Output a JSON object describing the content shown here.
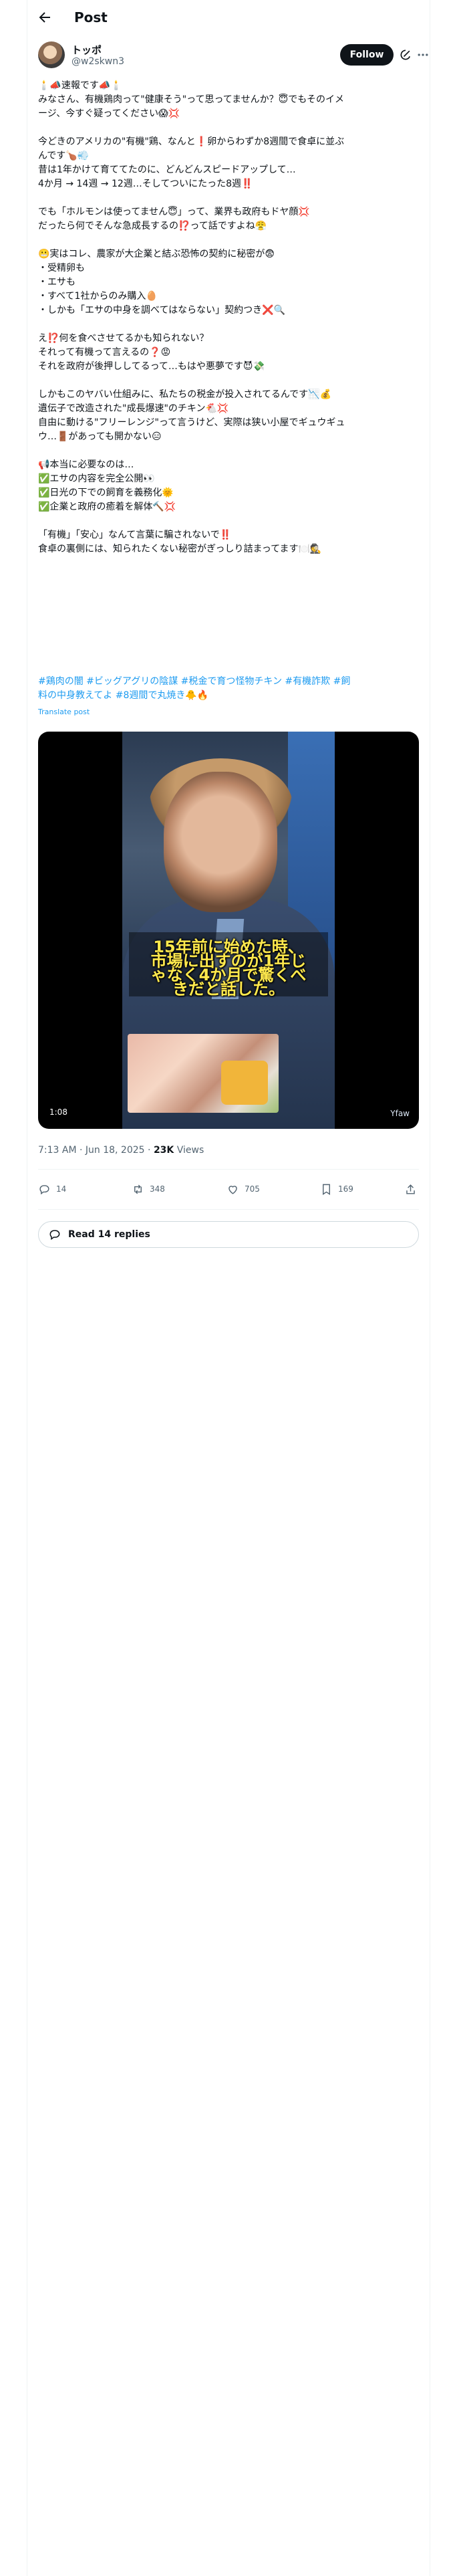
{
  "header": {
    "title": "Post"
  },
  "author": {
    "name": "トッポ",
    "handle": "@w2skwn3",
    "follow_label": "Follow"
  },
  "post": {
    "lines": [
      "🕯️📣速報です📣🕯️",
      "みなさん、有機鶏肉って\"健康そう\"って思ってませんか？😇でもそのイメ",
      "ージ、今すぐ疑ってください😱💢",
      "",
      "今どきのアメリカの\"有機\"鶏、なんと❗卵からわずか8週間で食卓に並ぶ",
      "んです🍗💨",
      "昔は1年かけて育ててたのに、どんどんスピードアップして…",
      "4か月 → 14週 → 12週…そしてついにたった8週‼️",
      "",
      "でも「ホルモンは使ってません😇」って、業界も政府もドヤ顔💢",
      "だったら何でそんな急成長するの⁉️って話ですよね😤",
      "",
      "😬実はコレ、農家が大企業と結ぶ恐怖の契約に秘密が😨",
      "・受精卵も",
      "・エサも",
      "・すべて1社からのみ購入🥚",
      "・しかも「エサの中身を調べてはならない」契約つき❌🔍",
      "",
      "え⁉️何を食べさせてるかも知られない？",
      "それって有機って言えるの❓😡",
      "それを政府が後押ししてるって…もはや悪夢です😈💸",
      "",
      "しかもこのヤバい仕組みに、私たちの税金が投入されてるんです📉💰",
      "遺伝子で改造された\"成長爆速\"のチキン🐔💢",
      "自由に動ける\"フリーレンジ\"って言うけど、実際は狭い小屋でギュウギュ",
      "ウ…🚪があっても開かない😑",
      "",
      "📢本当に必要なのは…",
      "✅エサの内容を完全公開👀",
      "✅日光の下での飼育を義務化🌞",
      "✅企業と政府の癒着を解体🔨💢",
      "",
      "「有機」「安心」なんて言葉に騙されないで‼️",
      "食卓の裏側には、知られたくない秘密がぎっしり詰まってます🍽️🕵️"
    ],
    "hashtag_lines": [
      "#鶏肉の闇 #ビッグアグリの陰謀 #税金で育つ怪物チキン #有機詐欺 #飼",
      "料の中身教えてよ #8週間で丸焼き🐥🔥"
    ],
    "translate_label": "Translate post",
    "video": {
      "caption_lines": [
        "15年前に始めた時、",
        "市場に出すのが1年じ",
        "ゃなく4か月で驚くべ",
        "きだと話した。"
      ],
      "duration": "1:08",
      "watermark": "Yfaw"
    },
    "timestamp": "7:13 AM · Jun 18, 2025",
    "separator": " · ",
    "views": "23K",
    "views_label": " Views"
  },
  "actions": {
    "replies": "14",
    "reposts": "348",
    "likes": "705",
    "bookmarks": "169"
  },
  "read_replies": {
    "label": "Read 14 replies"
  }
}
